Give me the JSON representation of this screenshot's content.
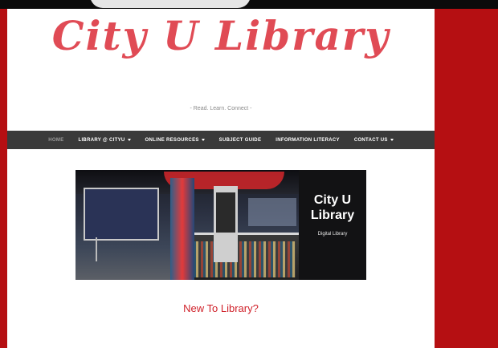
{
  "site": {
    "logo_text": "City U Library",
    "tagline": "- Read. Learn. Connect -"
  },
  "nav": {
    "items": [
      {
        "label": "HOME",
        "active": true,
        "dropdown": false
      },
      {
        "label": "LIBRARY @ CITYU",
        "dropdown": true
      },
      {
        "label": "ONLINE RESOURCES",
        "dropdown": true
      },
      {
        "label": "SUBJECT GUIDE",
        "dropdown": false
      },
      {
        "label": "INFORMATION LITERACY",
        "dropdown": false
      },
      {
        "label": "CONTACT US",
        "dropdown": true
      }
    ]
  },
  "banner": {
    "title_line1": "City U",
    "title_line2": "Library",
    "subtitle": "Digital Library"
  },
  "main": {
    "heading": "New To Library?"
  },
  "colors": {
    "brand_red": "#b50f12",
    "logo_red": "#e04b55",
    "heading_red": "#d0222b",
    "nav_bg": "#3a3a3a"
  }
}
